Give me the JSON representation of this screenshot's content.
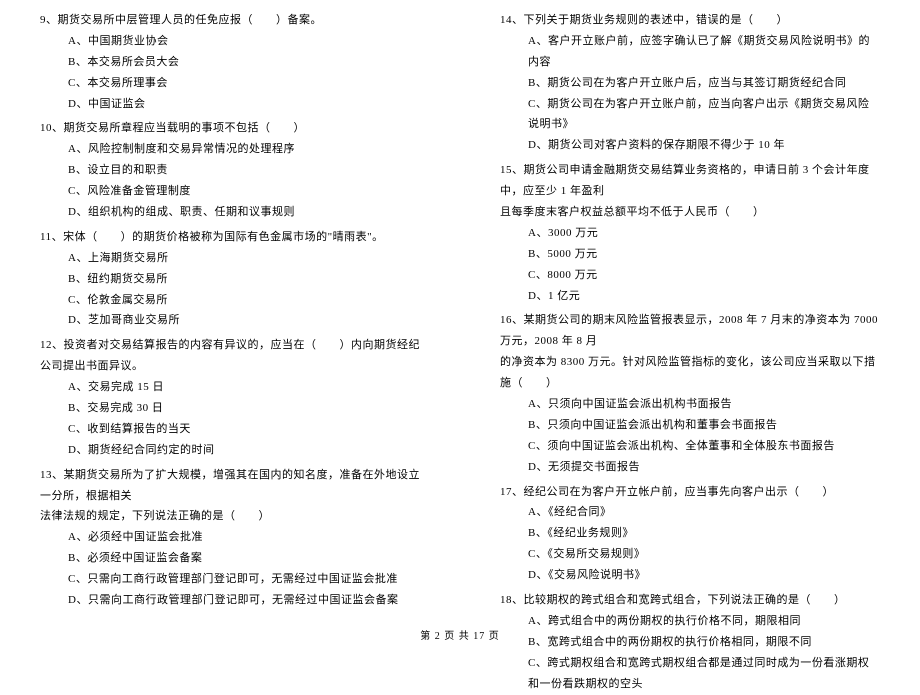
{
  "left": {
    "q9": {
      "text": "9、期货交易所中层管理人员的任免应报（　　）备案。",
      "opts": [
        "A、中国期货业协会",
        "B、本交易所会员大会",
        "C、本交易所理事会",
        "D、中国证监会"
      ]
    },
    "q10": {
      "text": "10、期货交易所章程应当载明的事项不包括（　　）",
      "opts": [
        "A、风险控制制度和交易异常情况的处理程序",
        "B、设立目的和职责",
        "C、风险准备金管理制度",
        "D、组织机构的组成、职责、任期和议事规则"
      ]
    },
    "q11": {
      "text": "11、宋体（　　）的期货价格被称为国际有色金属市场的\"晴雨表\"。",
      "opts": [
        "A、上海期货交易所",
        "B、纽约期货交易所",
        "C、伦敦金属交易所",
        "D、芝加哥商业交易所"
      ]
    },
    "q12": {
      "text": "12、投资者对交易结算报告的内容有异议的，应当在（　　）内向期货经纪公司提出书面异议。",
      "opts": [
        "A、交易完成 15 日",
        "B、交易完成 30 日",
        "C、收到结算报告的当天",
        "D、期货经纪合同约定的时间"
      ]
    },
    "q13": {
      "text": "13、某期货交易所为了扩大规模，增强其在国内的知名度，准备在外地设立一分所，根据相关",
      "cont": "法律法规的规定，下列说法正确的是（　　）",
      "opts": [
        "A、必须经中国证监会批准",
        "B、必须经中国证监会备案",
        "C、只需向工商行政管理部门登记即可，无需经过中国证监会批准",
        "D、只需向工商行政管理部门登记即可，无需经过中国证监会备案"
      ]
    }
  },
  "right": {
    "q14": {
      "text": "14、下列关于期货业务规则的表述中，错误的是（　　）",
      "opts": [
        "A、客户开立账户前，应签字确认已了解《期货交易风险说明书》的内容",
        "B、期货公司在为客户开立账户后，应当与其签订期货经纪合同",
        "C、期货公司在为客户开立账户前，应当向客户出示《期货交易风险说明书》",
        "D、期货公司对客户资料的保存期限不得少于 10 年"
      ]
    },
    "q15": {
      "text": "15、期货公司申请金融期货交易结算业务资格的，申请日前 3 个会计年度中，应至少 1 年盈利",
      "cont": "且每季度末客户权益总额平均不低于人民币（　　）",
      "opts": [
        "A、3000 万元",
        "B、5000 万元",
        "C、8000 万元",
        "D、1 亿元"
      ]
    },
    "q16": {
      "text": "16、某期货公司的期末风险监管报表显示，2008 年 7 月末的净资本为 7000 万元，2008 年 8 月",
      "cont": "的净资本为 8300 万元。针对风险监管指标的变化，该公司应当采取以下措施（　　）",
      "opts": [
        "A、只须向中国证监会派出机构书面报告",
        "B、只须向中国证监会派出机构和董事会书面报告",
        "C、须向中国证监会派出机构、全体董事和全体股东书面报告",
        "D、无须提交书面报告"
      ]
    },
    "q17": {
      "text": "17、经纪公司在为客户开立帐户前，应当事先向客户出示（　　）",
      "opts": [
        "A、《经纪合同》",
        "B、《经纪业务规则》",
        "C、《交易所交易规则》",
        "D、《交易风险说明书》"
      ]
    },
    "q18": {
      "text": "18、比较期权的跨式组合和宽跨式组合，下列说法正确的是（　　）",
      "opts": [
        "A、跨式组合中的两份期权的执行价格不同，期限相同",
        "B、宽跨式组合中的两份期权的执行价格相同，期限不同",
        "C、跨式期权组合和宽跨式期权组合都是通过同时成为一份看涨期权和一份看跌期权的空头"
      ]
    }
  },
  "footer": "第 2 页 共 17 页"
}
